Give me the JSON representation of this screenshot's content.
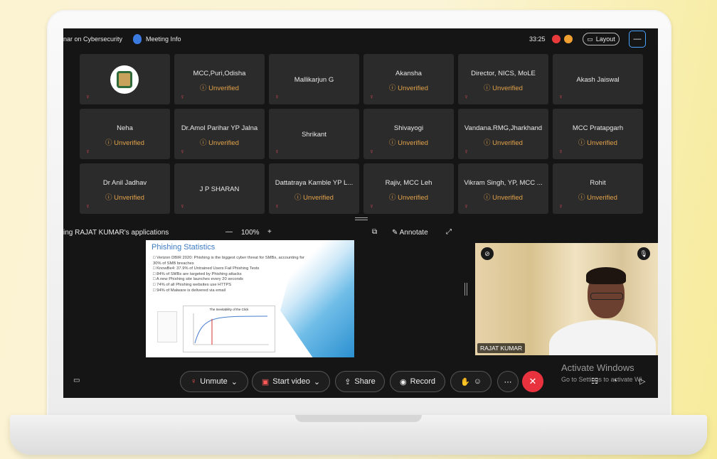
{
  "topbar": {
    "title": "nar on Cybersecurity",
    "meeting_info": "Meeting Info",
    "timer": "33:25",
    "layout_label": "Layout",
    "more": "—"
  },
  "tiles": [
    {
      "name": "",
      "logo": true,
      "status": ""
    },
    {
      "name": "MCC,Puri,Odisha",
      "status": "ⓘ Unverified"
    },
    {
      "name": "Mallikarjun G",
      "status": ""
    },
    {
      "name": "Akansha",
      "status": "ⓘ Unverified"
    },
    {
      "name": "Director, NICS, MoLE",
      "status": "ⓘ Unverified"
    },
    {
      "name": "Akash Jaiswal",
      "status": ""
    },
    {
      "name": "Neha",
      "status": "ⓘ Unverified"
    },
    {
      "name": "Dr.Amol Parihar YP Jalna",
      "status": "ⓘ Unverified"
    },
    {
      "name": "Shrikant",
      "status": ""
    },
    {
      "name": "Shivayogi",
      "status": "ⓘ Unverified"
    },
    {
      "name": "Vandana.RMG,Jharkhand",
      "status": "ⓘ Unverified"
    },
    {
      "name": "MCC Pratapgarh",
      "status": "ⓘ Unverified"
    },
    {
      "name": "Dr Anil Jadhav",
      "status": "ⓘ Unverified"
    },
    {
      "name": "J P SHARAN",
      "status": ""
    },
    {
      "name": "Dattatraya Kamble YP L...",
      "status": "ⓘ Unverified"
    },
    {
      "name": "Rajiv, MCC Leh",
      "status": "ⓘ Unverified"
    },
    {
      "name": "Vikram Singh, YP, MCC ...",
      "status": "ⓘ Unverified"
    },
    {
      "name": "Rohit",
      "status": "ⓘ Unverified"
    }
  ],
  "sharebar": {
    "label": "ing RAJAT KUMAR's applications",
    "minus": "—",
    "zoom": "100%",
    "plus": "+",
    "annotate": "Annotate"
  },
  "slide": {
    "title": "Phishing Statistics",
    "bullets": [
      "Verizon DBIR 2020: Phishing is the biggest cyber threat for SMBs, accounting for 30% of SMB breaches",
      "KnowBe4: 37.9% of Untrained Users Fail Phishing Tests",
      "84% of SMBs are targeted by Phishing attacks",
      "A new Phishing site launches every 20 seconds",
      "74% of all Phishing websites use HTTPS",
      "94% of Malware is delivered via email"
    ],
    "chart_title": "The Inevitability of the Click"
  },
  "speaker": {
    "name": "RAJAT KUMAR"
  },
  "watermark": {
    "line1": "Activate Windows",
    "line2": "Go to Settings to activate Wi"
  },
  "controls": {
    "unmute": "Unmute",
    "start_video": "Start video",
    "share": "Share",
    "record": "Record"
  }
}
